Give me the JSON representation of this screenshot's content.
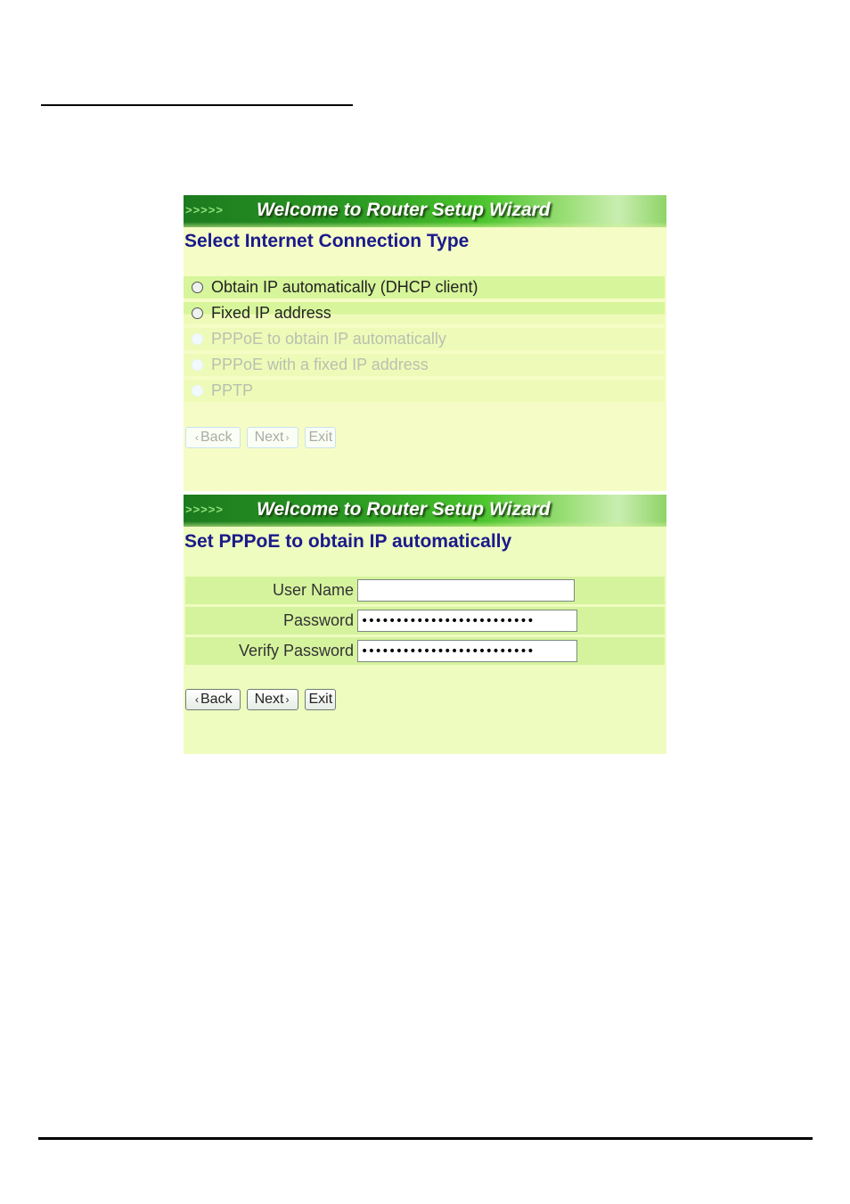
{
  "wizard_banner": {
    "arrows": ">>>>>",
    "title": "Welcome to Router Setup Wizard"
  },
  "panel1": {
    "heading": "Select Internet Connection Type",
    "options": [
      {
        "label": "Obtain IP automatically (DHCP client)",
        "enabled": true,
        "selected": false
      },
      {
        "label": "Fixed IP address",
        "enabled": true,
        "selected": false
      },
      {
        "label": "PPPoE to obtain IP automatically",
        "enabled": false,
        "selected": false
      },
      {
        "label": "PPPoE with a fixed IP address",
        "enabled": false,
        "selected": false
      },
      {
        "label": "PPTP",
        "enabled": false,
        "selected": false
      }
    ],
    "buttons": {
      "back": "Back",
      "next": "Next",
      "exit": "Exit"
    }
  },
  "panel2": {
    "heading": "Set PPPoE to obtain IP automatically",
    "fields": {
      "username": {
        "label": "User Name",
        "value": ""
      },
      "password": {
        "label": "Password",
        "value": "•••••••••••••••••••••••••"
      },
      "verify_password": {
        "label": "Verify Password",
        "value": "•••••••••••••••••••••••••"
      }
    },
    "buttons": {
      "back": "Back",
      "next": "Next",
      "exit": "Exit"
    }
  },
  "icons": {
    "back_chevron": "‹",
    "next_chevron": "›"
  }
}
